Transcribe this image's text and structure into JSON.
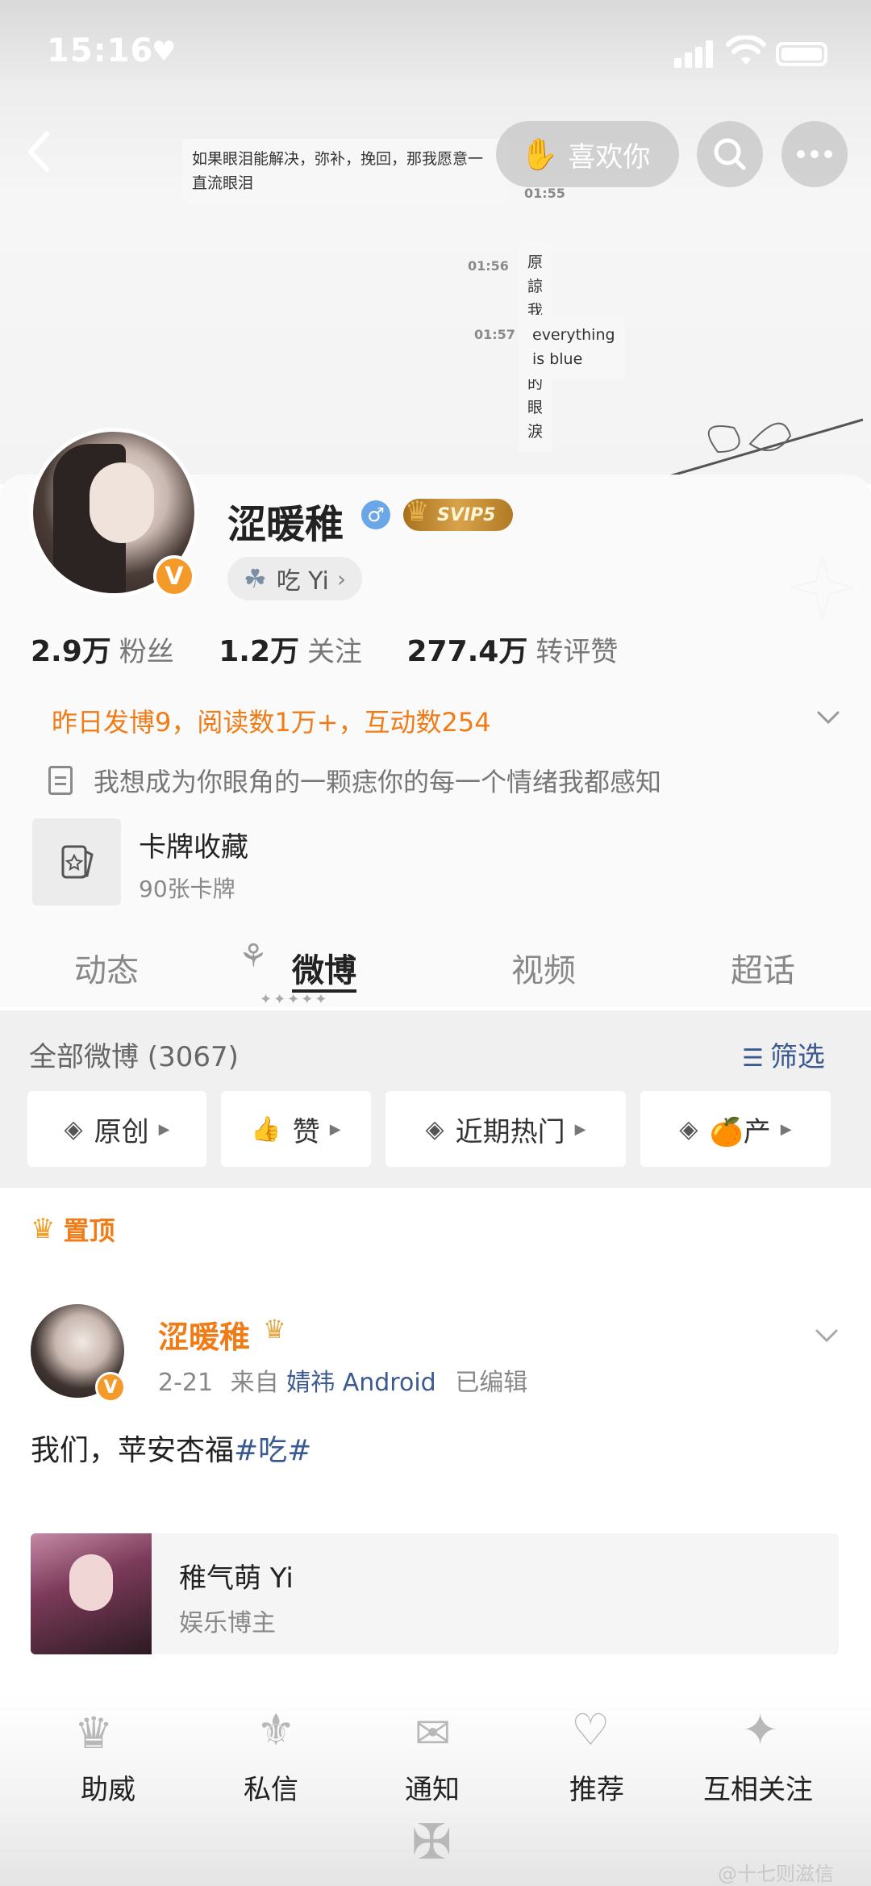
{
  "status": {
    "time": "15:16",
    "heart": "♥"
  },
  "header": {
    "like_label": "喜欢你",
    "chat": [
      {
        "text": "如果眼泪能解决，弥补，挽回，那我愿意一直流眼泪",
        "time": "01:55"
      },
      {
        "text": "原諒我廉價的眼淚",
        "time": "01:56"
      },
      {
        "text": "everything is blue",
        "time": "01:57"
      }
    ]
  },
  "profile": {
    "name": "涩暖稚",
    "gender_symbol": "♂",
    "vip_label": "SVIP5",
    "verified_mark": "V",
    "tag": "吃 Yi",
    "stats": [
      {
        "value": "2.9万",
        "label": "粉丝"
      },
      {
        "value": "1.2万",
        "label": "关注"
      },
      {
        "value": "277.4万",
        "label": "转评赞"
      }
    ],
    "activity": "昨日发博9，阅读数1万+，互动数254",
    "bio": "我想成为你眼角的一颗痣你的每一个情绪我都感知",
    "cards_title": "卡牌收藏",
    "cards_count": "90张卡牌"
  },
  "tabs": [
    "动态",
    "微博",
    "视频",
    "超话"
  ],
  "active_tab": "微博",
  "filter": {
    "count_label": "全部微博 (3067)",
    "sift_label": "筛选",
    "chips": [
      "原创",
      "赞",
      "近期热门",
      "🍊产"
    ]
  },
  "post": {
    "pinned_label": "置顶",
    "author": "涩暖稚",
    "date": "2-21",
    "from_label": "来自",
    "source": "婧祎 Android",
    "edited": "已编辑",
    "text": "我们，苹安杏福",
    "hashtag": "#吃#",
    "share_title": "稚气萌 Yi",
    "share_subtitle": "娱乐博主"
  },
  "bottom_bar": [
    "助威",
    "私信",
    "通知",
    "推荐",
    "互相关注"
  ],
  "watermark": "@十七则滋信",
  "colors": {
    "accent_orange": "#f07c18",
    "link_blue": "#3a5a91",
    "vip_gold": "#d7a34a"
  }
}
